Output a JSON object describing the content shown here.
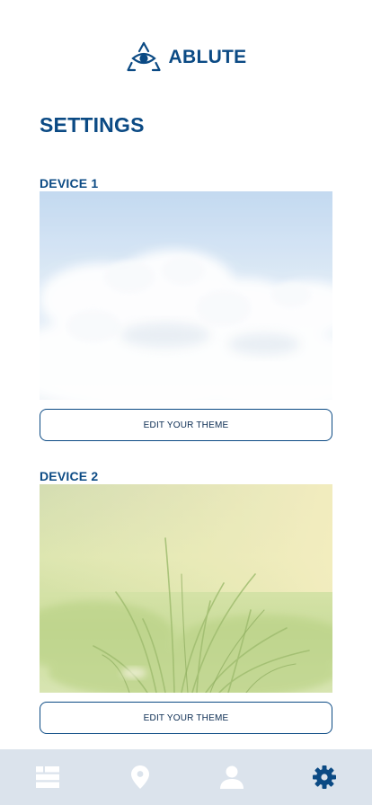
{
  "brand": {
    "name": "ABLUTE",
    "logo_icon": "eye-triangle-logo"
  },
  "page": {
    "title": "SETTINGS"
  },
  "devices": [
    {
      "label": "DEVICE 1",
      "image": "clouds-sky-image",
      "button_label": "EDIT YOUR THEME"
    },
    {
      "label": "DEVICE 2",
      "image": "grass-meadow-image",
      "button_label": "EDIT YOUR THEME"
    }
  ],
  "tabbar": {
    "items": [
      {
        "icon": "list-icon",
        "active": false
      },
      {
        "icon": "location-pin-icon",
        "active": false
      },
      {
        "icon": "user-icon",
        "active": false
      },
      {
        "icon": "gear-icon",
        "active": true
      }
    ]
  },
  "colors": {
    "primary": "#0b4a84",
    "tabbar_bg": "#dbe3ec",
    "tab_inactive": "#ffffff",
    "tab_active": "#0b4a84"
  }
}
